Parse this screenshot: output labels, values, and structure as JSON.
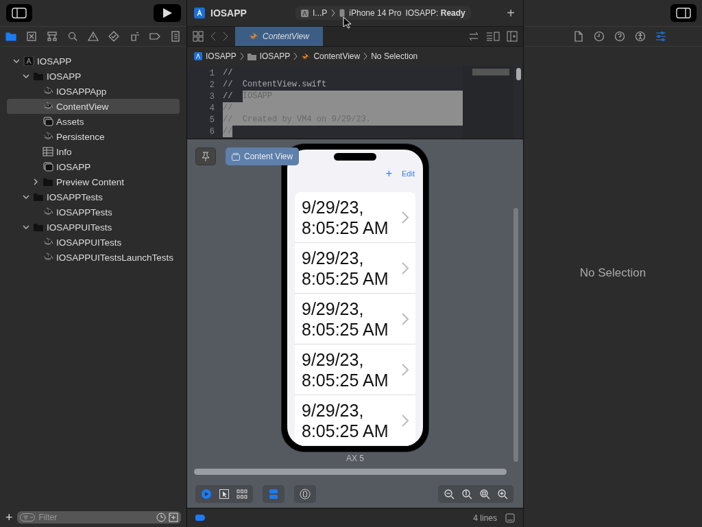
{
  "toolbar": {
    "project": "IOSAPP",
    "scheme": "I...P",
    "device": "iPhone 14 Pro",
    "status": "IOSAPP: **Ready**",
    "add": "+"
  },
  "navigator": {
    "tabs": [
      {
        "kind": "folder",
        "selected": true
      },
      {
        "kind": "source",
        "selected": false
      },
      {
        "kind": "hierarchy",
        "selected": false
      },
      {
        "kind": "search",
        "selected": false
      },
      {
        "kind": "warning",
        "selected": false
      },
      {
        "kind": "test",
        "selected": false
      },
      {
        "kind": "debug",
        "selected": false
      },
      {
        "kind": "breakpoint",
        "selected": false
      },
      {
        "kind": "report",
        "selected": false
      }
    ],
    "tree": [
      {
        "name": "IOSAPP",
        "kind": "project",
        "expanded": true,
        "selected": false,
        "children": [
          {
            "name": "IOSAPP",
            "kind": "folder",
            "expanded": true,
            "selected": false,
            "children": [
              {
                "name": "IOSAPPApp",
                "kind": "swift",
                "selected": false
              },
              {
                "name": "ContentView",
                "kind": "swift",
                "selected": true
              },
              {
                "name": "Assets",
                "kind": "assets",
                "selected": false
              },
              {
                "name": "Persistence",
                "kind": "swift",
                "selected": false
              },
              {
                "name": "Info",
                "kind": "plist",
                "selected": false
              },
              {
                "name": "IOSAPP",
                "kind": "datamodel",
                "selected": false
              },
              {
                "name": "Preview Content",
                "kind": "folder",
                "expanded": false,
                "selected": false
              }
            ]
          },
          {
            "name": "IOSAPPTests",
            "kind": "folder",
            "expanded": true,
            "selected": false,
            "children": [
              {
                "name": "IOSAPPTests",
                "kind": "swift",
                "selected": false
              }
            ]
          },
          {
            "name": "IOSAPPUITests",
            "kind": "folder",
            "expanded": true,
            "selected": false,
            "children": [
              {
                "name": "IOSAPPUITests",
                "kind": "swift",
                "selected": false
              },
              {
                "name": "IOSAPPUITestsLaunchTests",
                "kind": "swift",
                "selected": false
              }
            ]
          }
        ]
      }
    ],
    "add": "+",
    "filter": {
      "placeholder": "Filter"
    }
  },
  "editor": {
    "tab": "ContentView",
    "breadcrumbs": [
      {
        "text": "IOSAPP",
        "kind": "project"
      },
      {
        "text": "IOSAPP",
        "kind": "folder"
      },
      {
        "text": "ContentView",
        "kind": "swift"
      },
      {
        "text": "No Selection",
        "kind": "plain"
      }
    ],
    "lines": [
      {
        "number": "1",
        "segments": [
          {
            "text": "//",
            "selected": false
          }
        ],
        "selection_extends": false
      },
      {
        "number": "2",
        "segments": [
          {
            "text": "//  ContentView.swift",
            "selected": false
          }
        ],
        "selection_extends": false
      },
      {
        "number": "3",
        "segments": [
          {
            "text": "//  ",
            "selected": false
          },
          {
            "text": "IOSAPP",
            "selected": true
          }
        ],
        "selection_extends": true
      },
      {
        "number": "4",
        "segments": [
          {
            "text": "//",
            "selected": true
          }
        ],
        "selection_extends": true
      },
      {
        "number": "5",
        "segments": [
          {
            "text": "//  Created by VM4 on 9/29/23.",
            "selected": true
          }
        ],
        "selection_extends": true
      },
      {
        "number": "6",
        "segments": [
          {
            "text": "//",
            "selected": true
          }
        ],
        "selection_extends": false
      }
    ]
  },
  "preview": {
    "chip": {
      "label": "Content View",
      "selected": true
    },
    "pinned": false,
    "phone": {
      "add": "+",
      "edit": "Edit",
      "rows": [
        "9/29/23,\n8:05:25 AM",
        "9/29/23,\n8:05:25 AM",
        "9/29/23,\n8:05:25 AM",
        "9/29/23,\n8:05:25 AM",
        "9/29/23,\n8:05:25 AM"
      ]
    },
    "caption": "AX 5",
    "modes": [
      {
        "kind": "live",
        "selected": true
      },
      {
        "kind": "select",
        "selected": false
      },
      {
        "kind": "variants",
        "selected": false
      }
    ]
  },
  "status_bar": {
    "lines": "4 lines"
  },
  "inspector": {
    "tabs": [
      {
        "kind": "file",
        "selected": false
      },
      {
        "kind": "history",
        "selected": false
      },
      {
        "kind": "help",
        "selected": false
      },
      {
        "kind": "accessibility",
        "selected": false
      },
      {
        "kind": "attributes",
        "selected": true
      }
    ],
    "empty": "No Selection"
  }
}
